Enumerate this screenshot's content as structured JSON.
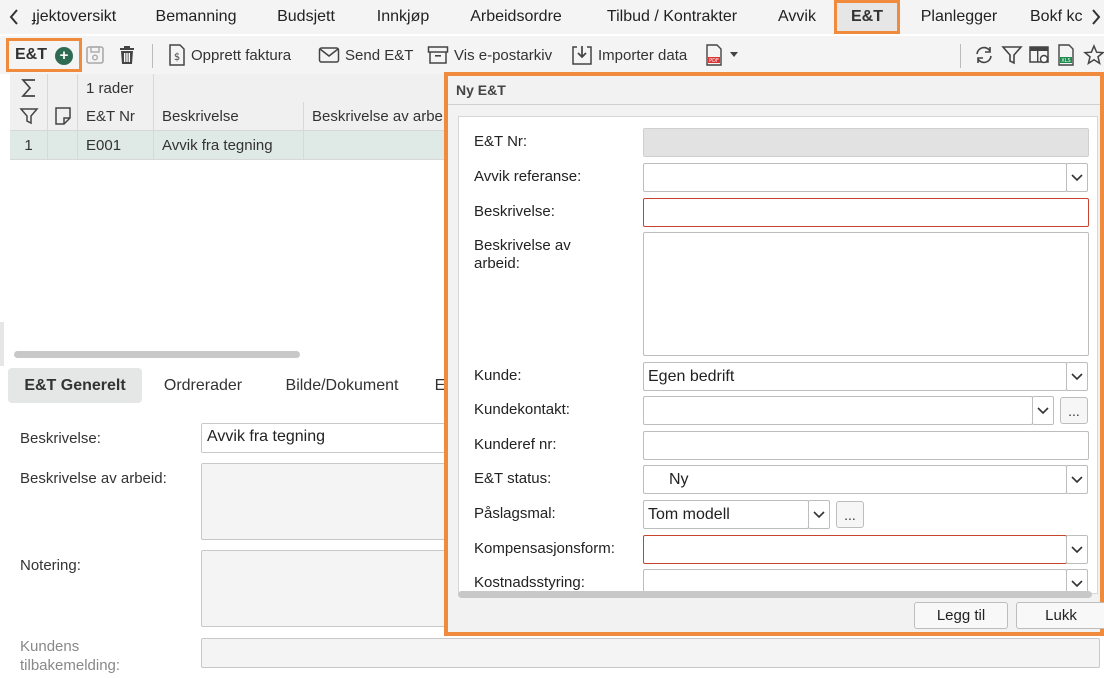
{
  "tabs": [
    {
      "label": "ɟjektoversikt"
    },
    {
      "label": "Bemanning"
    },
    {
      "label": "Budsjett"
    },
    {
      "label": "Innkjøp"
    },
    {
      "label": "Arbeidsordre"
    },
    {
      "label": "Tilbud / Kontrakter"
    },
    {
      "label": "Avvik"
    },
    {
      "label": "E&T"
    },
    {
      "label": "Planlegger"
    },
    {
      "label": "Bokf kc"
    }
  ],
  "toolbar": {
    "module_label": "E&T",
    "create_invoice": "Opprett faktura",
    "send": "Send E&T",
    "email_archive": "Vis e-postarkiv",
    "import": "Importer data"
  },
  "grid": {
    "row_count": "1 rader",
    "columns": [
      "E&T Nr",
      "Beskrivelse",
      "Beskrivelse av arbe"
    ],
    "rows": [
      {
        "index": "1",
        "nr": "E001",
        "desc": "Avvik fra tegning",
        "work": ""
      }
    ]
  },
  "detail_tabs": [
    "E&T Generelt",
    "Ordrerader",
    "Bilde/Dokument",
    "E"
  ],
  "detail": {
    "beskrivelse_label": "Beskrivelse:",
    "beskrivelse_value": "Avvik fra tegning",
    "arbeid_label": "Beskrivelse av arbeid:",
    "notering_label": "Notering:",
    "kundens_label_1": "Kundens",
    "kundens_label_2": "tilbakemelding:"
  },
  "dialog": {
    "title": "Ny E&T",
    "labels": {
      "nr": "E&T Nr:",
      "avvik_ref": "Avvik referanse:",
      "beskrivelse": "Beskrivelse:",
      "arbeid_1": "Beskrivelse av",
      "arbeid_2": "arbeid:",
      "kunde": "Kunde:",
      "kundekontakt": "Kundekontakt:",
      "kunderef": "Kunderef nr:",
      "status": "E&T status:",
      "paslagsmal": "Påslagsmal:",
      "kompensasjon": "Kompensasjonsform:",
      "kostnad": "Kostnadsstyring:"
    },
    "values": {
      "kunde": "Egen bedrift",
      "status": "Ny",
      "paslagsmal": "Tom modell"
    },
    "ellipsis": "...",
    "add_button": "Legg til",
    "close_button": "Lukk"
  },
  "colors": {
    "highlight": "#f08a3c",
    "add_icon": "#2f6b52",
    "required_border": "#c7442f"
  }
}
